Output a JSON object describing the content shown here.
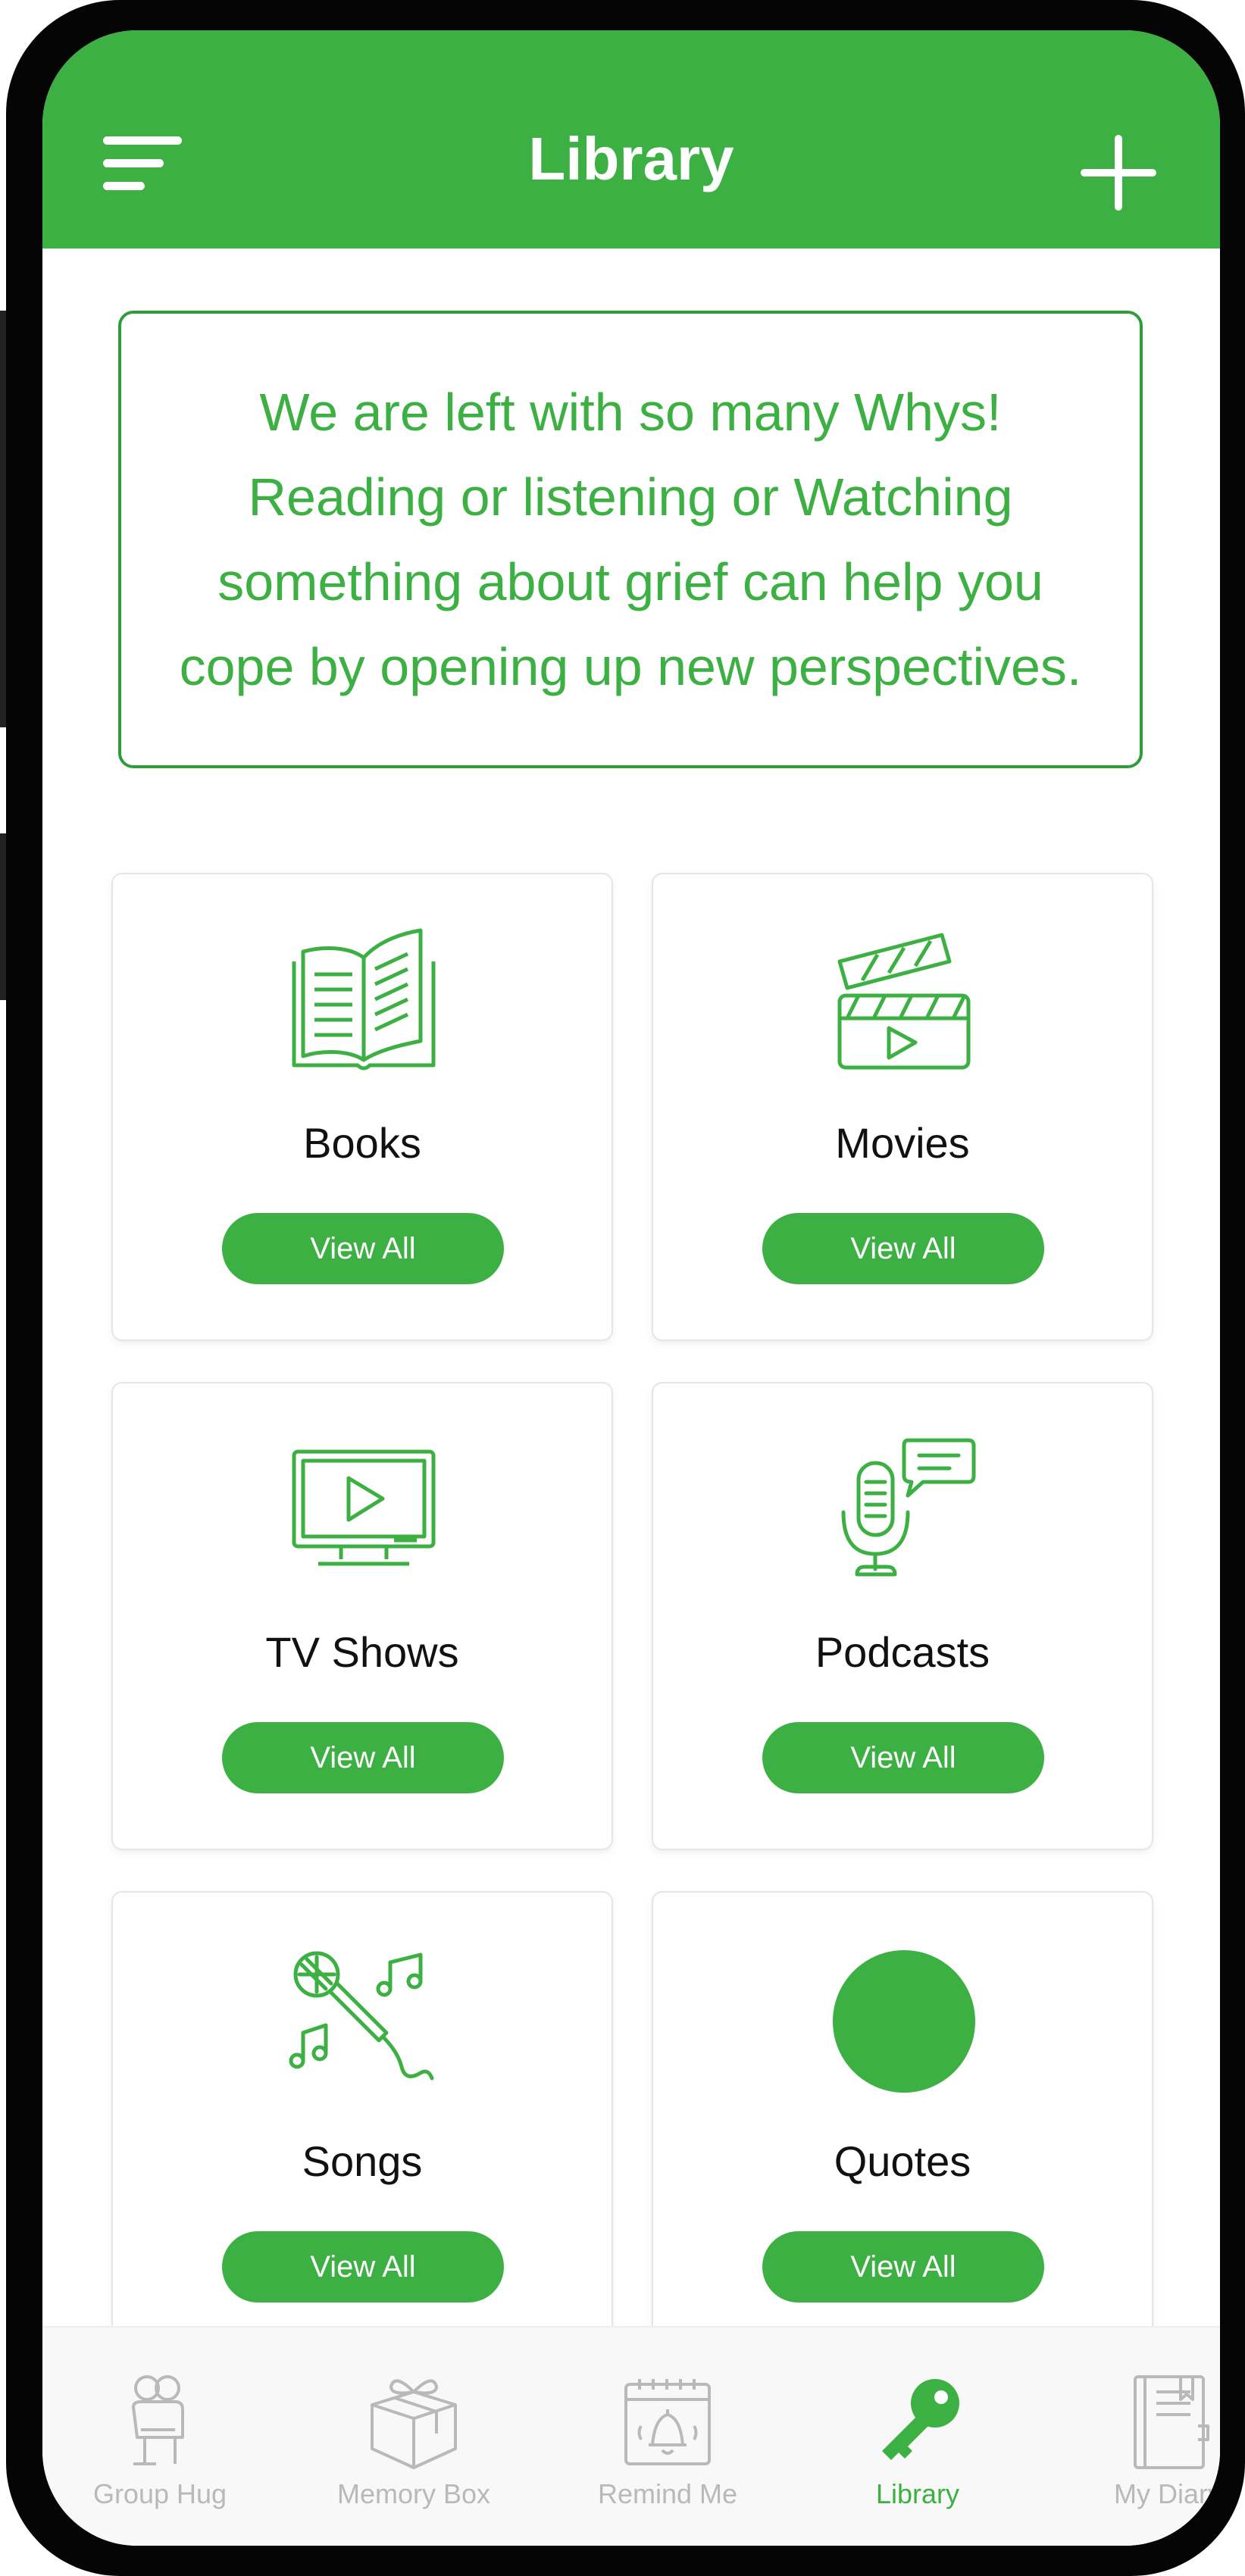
{
  "header": {
    "title": "Library"
  },
  "intro": {
    "text": "We are left with so many Whys! Reading or listening or Watching something about grief can help you cope by opening up new perspectives."
  },
  "categories": [
    {
      "label": "Books",
      "icon": "open-book-icon",
      "button": "View All"
    },
    {
      "label": "Movies",
      "icon": "clapperboard-icon",
      "button": "View All"
    },
    {
      "label": "TV Shows",
      "icon": "tv-icon",
      "button": "View All"
    },
    {
      "label": "Podcasts",
      "icon": "podcast-microphone-icon",
      "button": "View All"
    },
    {
      "label": "Songs",
      "icon": "karaoke-microphone-icon",
      "button": "View All"
    },
    {
      "label": "Quotes",
      "icon": "circle-icon",
      "button": "View All"
    }
  ],
  "tabbar": {
    "items": [
      {
        "label": "Group Hug",
        "icon": "hug-icon",
        "active": false
      },
      {
        "label": "Memory Box",
        "icon": "gift-box-icon",
        "active": false
      },
      {
        "label": "Remind Me",
        "icon": "calendar-bell-icon",
        "active": false
      },
      {
        "label": "Library",
        "icon": "key-icon",
        "active": true
      },
      {
        "label": "My Diary",
        "icon": "diary-icon",
        "active": false
      }
    ]
  },
  "colors": {
    "accent": "#3cb043",
    "inactive": "#b9b9b9",
    "frame": "#050505"
  }
}
